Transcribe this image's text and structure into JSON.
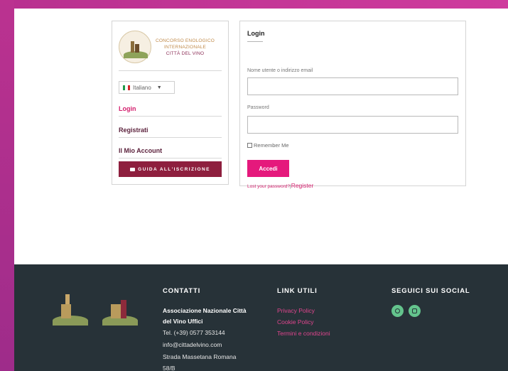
{
  "sidebar": {
    "logo_lines": [
      "CONCORSO ENOLOGICO",
      "INTERNAZIONALE",
      "CITTÀ DEL VINO"
    ],
    "language": "Italiano",
    "links": [
      {
        "label": "Login",
        "active": true
      },
      {
        "label": "Registrati",
        "active": false
      },
      {
        "label": "Il Mio Account",
        "active": false
      }
    ],
    "guide_button": "GUIDA ALL'ISCRIZIONE"
  },
  "login": {
    "title": "Login",
    "username_label": "Nome utente o indirizzo email",
    "password_label": "Password",
    "remember_label": "Remember Me",
    "submit_label": "Accedi",
    "lost_password": "Lost your password?",
    "separator": "|",
    "register_link": "Register"
  },
  "footer": {
    "contacts": {
      "heading": "CONTATTI",
      "org_line1": "Associazione Nazionale Città",
      "org_line2": "del Vino Uffici",
      "phone": "Tel. (+39) 0577 353144",
      "email": "info@cittadelvino.com",
      "address1": "Strada Massetana Romana",
      "address2": "58/B"
    },
    "links": {
      "heading": "LINK UTILI",
      "items": [
        "Privacy Policy",
        "Cookie Policy",
        "Termini e condizioni"
      ]
    },
    "social": {
      "heading": "SEGUICI SUI SOCIAL",
      "icons": [
        "facebook-icon",
        "instagram-icon"
      ]
    }
  },
  "colors": {
    "accent": "#e5197c",
    "link": "#d4206e",
    "guide_button": "#8e1f3e",
    "footer_bg": "#273238",
    "social": "#64c48d"
  }
}
